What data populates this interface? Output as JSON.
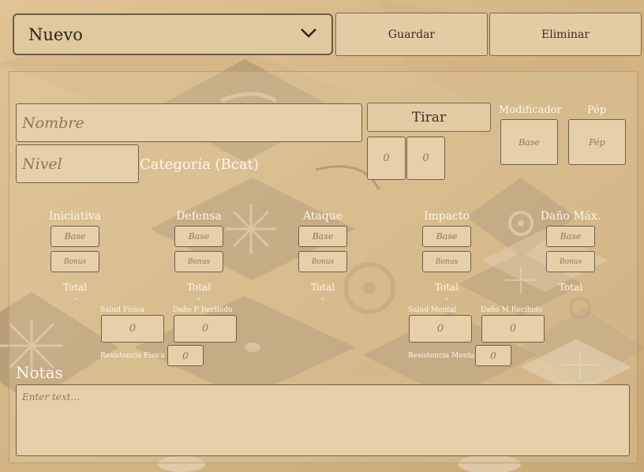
{
  "toolbar": {
    "select_value": "Nuevo",
    "save_label": "Guardar",
    "delete_label": "Eliminar"
  },
  "form": {
    "name_placeholder": "Nombre",
    "level_placeholder": "Nivel",
    "category_label": "Categoría (Bcat)",
    "roll_label": "Tirar",
    "roll_values": [
      "0",
      "0"
    ],
    "modifier_label": "Modificador",
    "modifier_placeholder": "Base",
    "pep_label": "Pép",
    "pep_placeholder": "Pép"
  },
  "stats": [
    {
      "label": "Iniciativa",
      "base": "Base",
      "bonus": "Bonus",
      "total_label": "Total",
      "total_value": "-"
    },
    {
      "label": "Defensa",
      "base": "Base",
      "bonus": "Bonus",
      "total_label": "Total",
      "total_value": "-"
    },
    {
      "label": "Ataque",
      "base": "Base",
      "bonus": "Bonus",
      "total_label": "Total",
      "total_value": "-"
    },
    {
      "label": "Impacto",
      "base": "Base",
      "bonus": "Bonus",
      "total_label": "Total",
      "total_value": "-"
    },
    {
      "label": "Daño Máx.",
      "base": "Base",
      "bonus": "Bonus",
      "total_label": "Total",
      "total_value": ""
    }
  ],
  "health": {
    "physical_health_label": "Salud Física",
    "physical_health_value": "0",
    "physical_damage_label": "Daño F Recibido",
    "physical_damage_value": "0",
    "physical_resistance_label": "Resistencia Física",
    "physical_resistance_value": "0",
    "mental_health_label": "Salud Mental",
    "mental_health_value": "0",
    "mental_damage_label": "Daño M Recibido",
    "mental_damage_value": "0",
    "mental_resistance_label": "Resistencia Mental",
    "mental_resistance_value": "0"
  },
  "notes": {
    "title": "Notas",
    "placeholder": "Enter text..."
  },
  "colors": {
    "panel_bg": "#d9b98a",
    "field_bg": "#e7d0a9",
    "label_text": "#fff6e8"
  },
  "icons": {
    "dropdown": "chevron-down-icon"
  }
}
